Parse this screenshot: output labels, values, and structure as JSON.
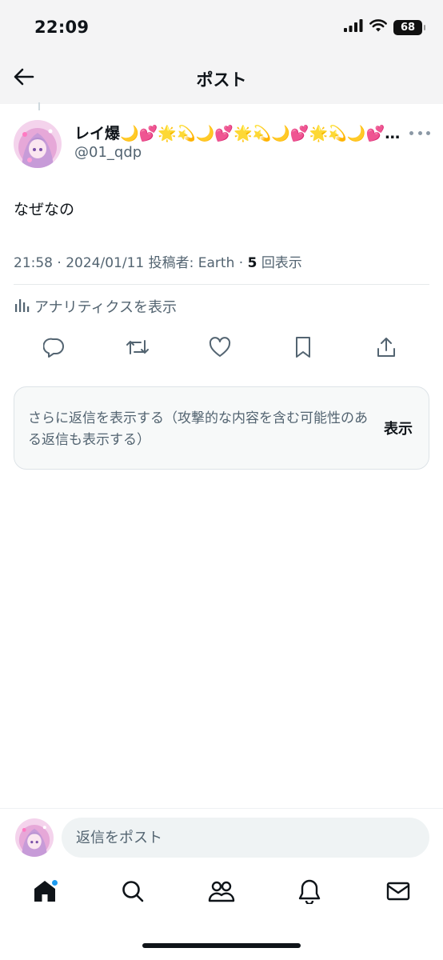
{
  "status_bar": {
    "time": "22:09",
    "battery": "68",
    "icons": [
      "signal-icon",
      "wifi-icon",
      "battery-icon"
    ]
  },
  "header": {
    "title": "ポスト",
    "back_icon": "back-arrow-icon"
  },
  "post": {
    "author_name": "レイ爆🌙💕🌟💫🌙💕🌟💫🌙💕🌟💫🌙💕🌟💫",
    "handle": "@01_qdp",
    "text": "なぜなの",
    "meta": {
      "time": "21:58",
      "date": "2024/01/11",
      "source_label": "投稿者:",
      "source": "Earth",
      "views_count": "5",
      "views_label": "回表示"
    },
    "analytics_label": "アナリティクスを表示",
    "actions": [
      "reply-icon",
      "repost-icon",
      "like-icon",
      "bookmark-icon",
      "share-icon"
    ]
  },
  "more_replies": {
    "text": "さらに返信を表示する（攻撃的な内容を含む可能性のある返信も表示する）",
    "button": "表示"
  },
  "reply_bar": {
    "placeholder": "返信をポスト"
  },
  "bottom_nav": {
    "items": [
      "home-icon",
      "search-icon",
      "communities-icon",
      "notifications-icon",
      "messages-icon"
    ]
  },
  "colors": {
    "text_primary": "#0f1419",
    "text_secondary": "#536471",
    "accent": "#1d9bf0",
    "header_bg": "#f4f4f5"
  }
}
